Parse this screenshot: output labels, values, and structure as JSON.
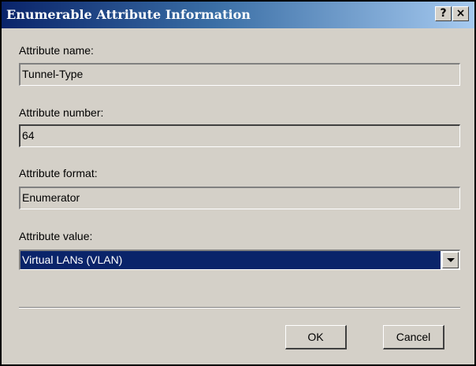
{
  "window": {
    "title": "Enumerable Attribute Information",
    "help_glyph": "?",
    "close_glyph": "×"
  },
  "fields": {
    "name_label": "Attribute name:",
    "name_value": "Tunnel-Type",
    "number_label": "Attribute number:",
    "number_value": "64",
    "format_label": "Attribute format:",
    "format_value": "Enumerator",
    "value_label": "Attribute value:",
    "value_selected": "Virtual LANs (VLAN)"
  },
  "buttons": {
    "ok": "OK",
    "cancel": "Cancel"
  },
  "colors": {
    "titlebar_start": "#0a246a",
    "titlebar_end": "#a6caf0",
    "dialog_bg": "#d4d0c8",
    "selection": "#0a246a"
  },
  "icons": {
    "help": "help-icon",
    "close": "close-icon",
    "dropdown": "chevron-down-icon"
  }
}
